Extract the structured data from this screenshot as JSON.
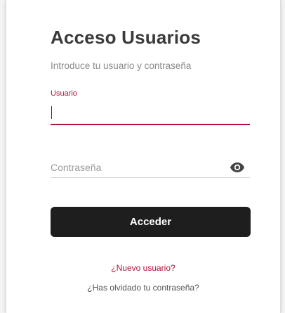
{
  "login": {
    "title": "Acceso Usuarios",
    "subtitle": "Introduce tu usuario y contraseña",
    "username": {
      "label": "Usuario",
      "value": ""
    },
    "password": {
      "placeholder": "Contraseña",
      "value": "",
      "toggle_icon": "eye-icon"
    },
    "submit_label": "Acceder",
    "new_user_link": "¿Nuevo usuario?",
    "forgot_password_link": "¿Has olvidado tu contraseña?"
  },
  "colors": {
    "accent": "#b3123a",
    "button_bg": "#1e1e1e",
    "button_text": "#ffffff",
    "title": "#3a3a3a",
    "muted_text": "#8a8a8a"
  }
}
